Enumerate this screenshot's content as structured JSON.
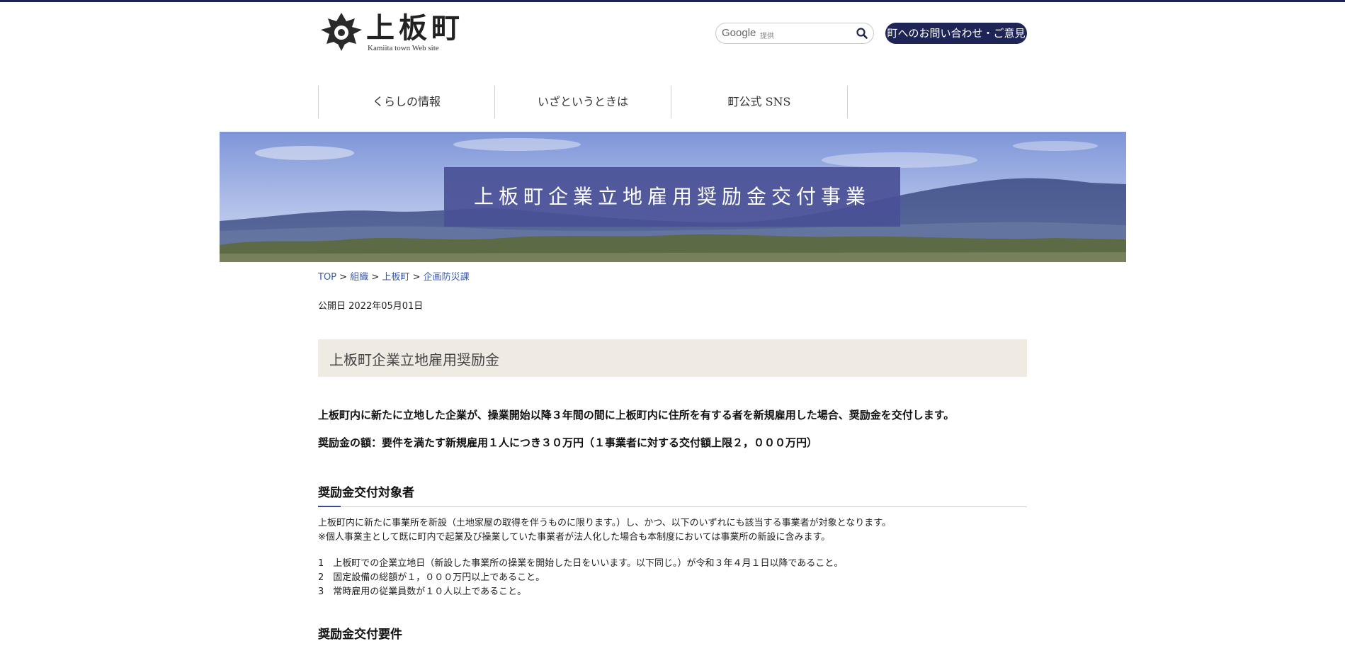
{
  "header": {
    "logo_title": "上板町",
    "logo_subtitle": "Kamiita town Web site",
    "search_brand": "Google",
    "search_provider": "提供",
    "contact_label": "町へのお問い合わせ・ご意見"
  },
  "nav": {
    "items": [
      {
        "label": "くらしの情報"
      },
      {
        "label": "いざというときは"
      },
      {
        "label": "町公式 SNS"
      }
    ]
  },
  "banner": {
    "title": "上板町企業立地雇用奨励金交付事業"
  },
  "breadcrumb": {
    "items": [
      "TOP",
      "組織",
      "上板町",
      "企画防災課"
    ],
    "separator": ">"
  },
  "published": "公開日 2022年05月01日",
  "page_heading": "上板町企業立地雇用奨励金",
  "lead": [
    "上板町内に新たに立地した企業が、操業開始以降３年間の間に上板町内に住所を有する者を新規雇用した場合、奨励金を交付します。",
    "奨励金の額：要件を満たす新規雇用１人につき３０万円（１事業者に対する交付額上限２，０００万円）"
  ],
  "section1": {
    "heading": "奨励金交付対象者",
    "intro": [
      "上板町内に新たに事業所を新設（土地家屋の取得を伴うものに限ります。）し、かつ、以下のいずれにも該当する事業者が対象となります。",
      "※個人事業主として既に町内で起業及び操業していた事業者が法人化した場合も本制度においては事業所の新設に含みます。"
    ],
    "list": [
      "1　上板町での企業立地日（新設した事業所の操業を開始した日をいいます。以下同じ。）が令和３年４月１日以降であること。",
      "2　固定設備の総額が１，０００万円以上であること。",
      "3　常時雇用の従業員数が１０人以上であること。"
    ]
  },
  "section2": {
    "heading": "奨励金交付要件"
  },
  "colors": {
    "navy": "#1e2456",
    "banner_overlay": "#4a5096",
    "heading_bg": "#efebe3",
    "link": "#3b5ba8"
  }
}
